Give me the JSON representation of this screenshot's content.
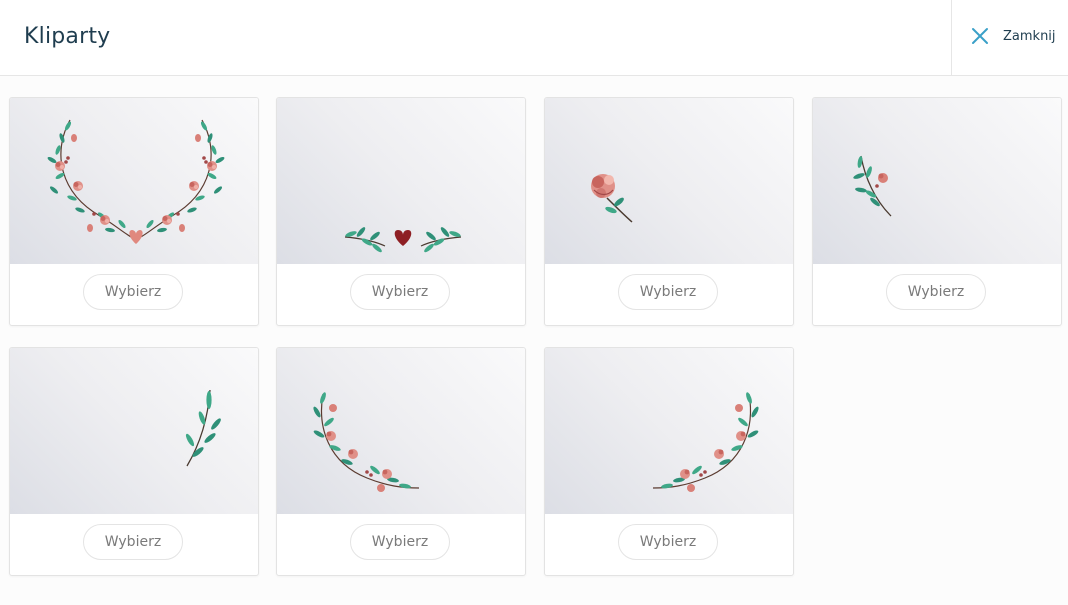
{
  "header": {
    "title": "Kliparty",
    "close_label": "Zamknij",
    "close_icon": "close-icon"
  },
  "colors": {
    "title_text": "#1f3d4f",
    "close_icon": "#3aa0c8",
    "button_text": "#7a7a7a",
    "leaf": "#3fa888",
    "flower": "#d98078",
    "stem": "#5b3b30"
  },
  "cliparts": [
    {
      "name": "floral-wreath-clipart",
      "button_label": "Wybierz"
    },
    {
      "name": "leaves-heart-clipart",
      "button_label": "Wybierz"
    },
    {
      "name": "single-flower-clipart",
      "button_label": "Wybierz"
    },
    {
      "name": "flower-sprig-clipart",
      "button_label": "Wybierz"
    },
    {
      "name": "leaf-branch-clipart",
      "button_label": "Wybierz"
    },
    {
      "name": "left-corner-wreath-clipart",
      "button_label": "Wybierz"
    },
    {
      "name": "right-corner-wreath-clipart",
      "button_label": "Wybierz"
    }
  ]
}
